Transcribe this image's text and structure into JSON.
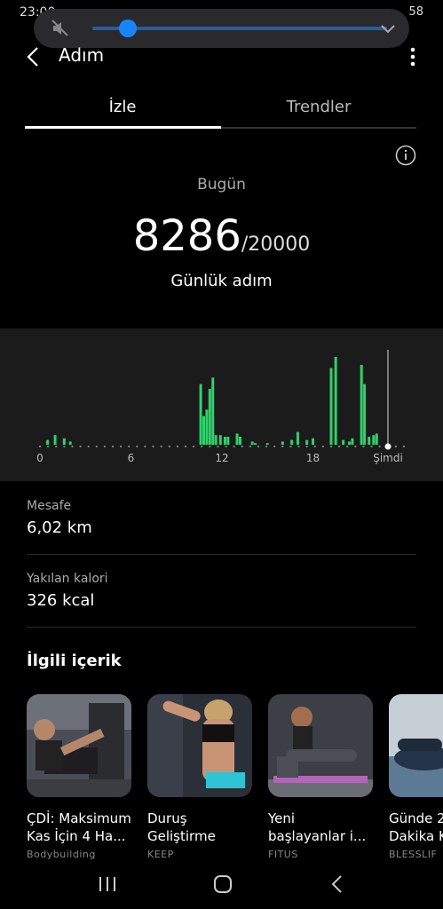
{
  "status": {
    "time": "23:00",
    "right": "58"
  },
  "header": {
    "title": "Adım"
  },
  "tabs": [
    {
      "label": "İzle"
    },
    {
      "label": "Trendler"
    }
  ],
  "today": {
    "label": "Bugün",
    "steps": "8286",
    "goal": "/20000",
    "unit_label": "Günlük adım"
  },
  "chart_data": {
    "type": "bar",
    "title": "",
    "xlabel": "",
    "ylabel": "",
    "x_ticks": [
      "0",
      "6",
      "12",
      "18",
      "Şimdi"
    ],
    "x": [
      0.5,
      1,
      1.6,
      2,
      10.6,
      10.8,
      11,
      11.2,
      11.4,
      11.6,
      11.9,
      12.2,
      12.4,
      13,
      13.2,
      14,
      14.2,
      15,
      16,
      16.6,
      17,
      17.6,
      18,
      19.2,
      19.5,
      20,
      20.4,
      20.6,
      21.2,
      21.4,
      21.7,
      22,
      22.2
    ],
    "values": [
      3,
      6,
      4,
      2,
      38,
      18,
      22,
      35,
      42,
      6,
      6,
      5,
      5,
      7,
      5,
      2,
      1,
      1,
      2,
      3,
      8,
      3,
      4,
      48,
      55,
      3,
      2,
      4,
      50,
      38,
      5,
      6,
      7
    ],
    "ylim": [
      0,
      60
    ],
    "xlim": [
      0,
      24
    ],
    "color": "#2fd26a"
  },
  "stats": {
    "distance": {
      "label": "Mesafe",
      "value": "6,02 km"
    },
    "calories": {
      "label": "Yakılan kalori",
      "value": "326 kcal"
    }
  },
  "related": {
    "title": "İlgili içerik",
    "cards": [
      {
        "title": "ÇDİ: Maksimum Kas İçin 4 Ha...",
        "source": "Bodybuilding"
      },
      {
        "title": "Duruş Geliştirme",
        "source": "KEEP"
      },
      {
        "title": "Yeni başlayanlar i...",
        "source": "FITUS"
      },
      {
        "title": "Günde 2 Dakika K",
        "source": "BLESSLIF"
      }
    ]
  },
  "colors": {
    "accent": "#1a84ff",
    "bar": "#2fd26a"
  }
}
